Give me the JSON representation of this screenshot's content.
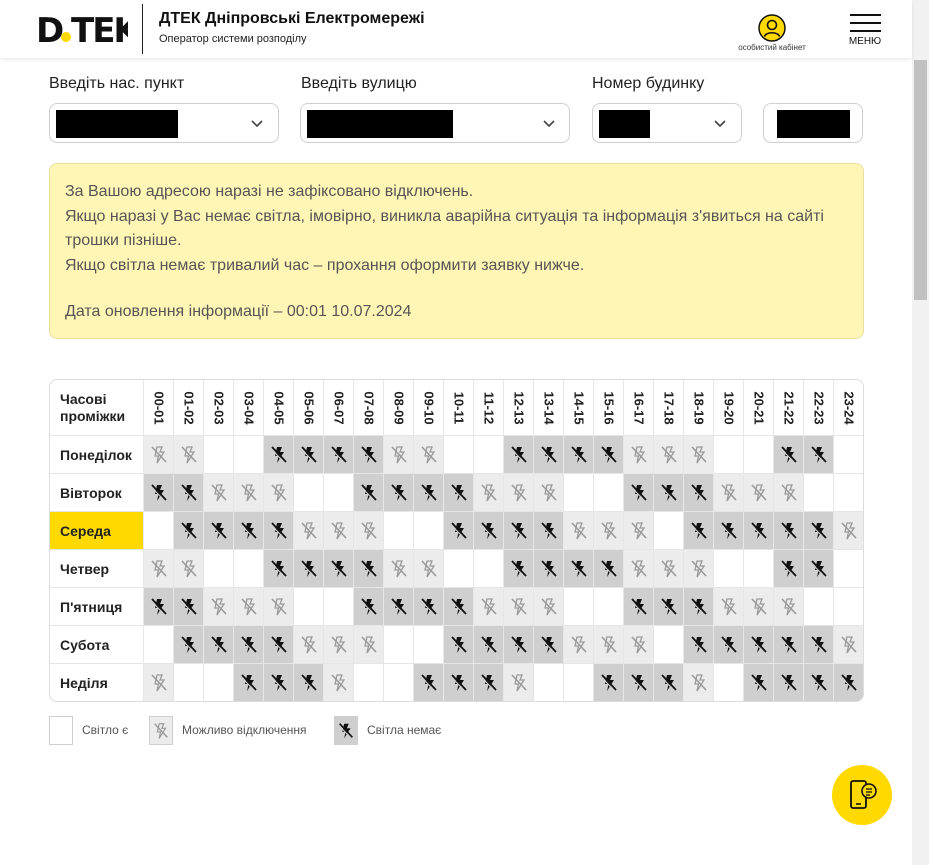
{
  "header": {
    "logo": "ДТЕК",
    "title": "ДТЕК Дніпровські Електромережі",
    "subtitle": "Оператор системи розподілу",
    "cabinet_label": "особистий кабінет",
    "menu_label": "МЕНЮ"
  },
  "form": {
    "city_label": "Введіть нас. пункт",
    "street_label": "Введіть вулицю",
    "house_label": "Номер будинку"
  },
  "notice": {
    "line1": "За Вашою адресою наразі не зафіксовано відключень.",
    "line2": "Якщо наразі у Вас немає світла, імовірно, виникла аварійна ситуація та інформація з'явиться на сайті трошки пізніше.",
    "line3": "Якщо світла немає тривалий час – прохання оформити заявку нижче.",
    "updated": "Дата оновлення інформації – 00:01 10.07.2024"
  },
  "schedule": {
    "header_line1": "Часові",
    "header_line2": "проміжки",
    "hours": [
      "00-01",
      "01-02",
      "02-03",
      "03-04",
      "04-05",
      "05-06",
      "06-07",
      "07-08",
      "08-09",
      "09-10",
      "10-11",
      "11-12",
      "12-13",
      "13-14",
      "14-15",
      "15-16",
      "16-17",
      "17-18",
      "18-19",
      "19-20",
      "20-21",
      "21-22",
      "22-23",
      "23-24"
    ],
    "current_day_index": 2,
    "days": [
      {
        "name": "Понеділок",
        "slots": "mm00xxxxmm00xxxxmmm00xx"
      },
      {
        "name": "Вівторок",
        "slots": "xxmmm00xxxxmmm00xxxmmm0"
      },
      {
        "name": "Середа",
        "slots": "0xxxxmmm00xxxxmmm0xxxxxm"
      },
      {
        "name": "Четвер",
        "slots": "mm00xxxxmm00xxxxmmm00xx"
      },
      {
        "name": "П'ятниця",
        "slots": "xxmmm00xxxxmmm00xxxmmm0"
      },
      {
        "name": "Субота",
        "slots": "0xxxxmmm00xxxxmmm0xxxxxm"
      },
      {
        "name": "Неділя",
        "slots": "m00xxxm00xxxm00xxxm0xxxx"
      }
    ]
  },
  "legend": {
    "on": "Світло є",
    "maybe": "Можливо відключення",
    "off": "Світла немає"
  },
  "colors": {
    "accent": "#ffd900",
    "notice_bg": "#fff6b5",
    "maybe_bg": "#ececec",
    "off_bg": "#cfcfcf"
  }
}
